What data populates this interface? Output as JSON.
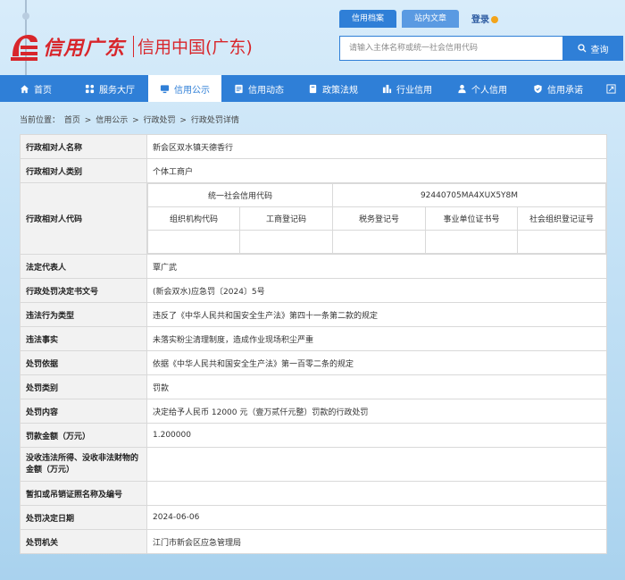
{
  "header": {
    "logo_script": "信用广东",
    "logo_name": "信用中国(广东)",
    "search_tabs": [
      "信用档案",
      "站内文章"
    ],
    "login_label": "登录",
    "search_placeholder": "请输入主体名称或统一社会信用代码",
    "search_button": "查询"
  },
  "nav": {
    "items": [
      {
        "label": "首页",
        "icon": "home-icon"
      },
      {
        "label": "服务大厅",
        "icon": "grid-icon"
      },
      {
        "label": "信用公示",
        "icon": "monitor-icon",
        "active": true
      },
      {
        "label": "信用动态",
        "icon": "news-icon"
      },
      {
        "label": "政策法规",
        "icon": "book-icon"
      },
      {
        "label": "行业信用",
        "icon": "building-icon"
      },
      {
        "label": "个人信用",
        "icon": "person-icon"
      },
      {
        "label": "信用承诺",
        "icon": "shield-icon"
      }
    ],
    "extra_icon": "expand-icon"
  },
  "breadcrumb": {
    "prefix": "当前位置：",
    "items": [
      "首页",
      "信用公示",
      "行政处罚",
      "行政处罚详情"
    ],
    "separator": ">"
  },
  "detail": {
    "name_label": "行政相对人名称",
    "name_value": "新会区双水镇天德香行",
    "type_label": "行政相对人类别",
    "type_value": "个体工商户",
    "code_label": "行政相对人代码",
    "usc_label": "统一社会信用代码",
    "usc_value": "92440705MA4XUX5Y8M",
    "sub_headers": [
      "组织机构代码",
      "工商登记码",
      "税务登记号",
      "事业单位证书号",
      "社会组织登记证号"
    ],
    "rep_label": "法定代表人",
    "rep_value": "覃广武",
    "doc_label": "行政处罚决定书文号",
    "doc_value": "(新会双水)应急罚〔2024〕5号",
    "violation_type_label": "违法行为类型",
    "violation_type_value": "违反了《中华人民共和国安全生产法》第四十一条第二款的规定",
    "facts_label": "违法事实",
    "facts_value": "未落实粉尘清理制度，造成作业现场积尘严重",
    "basis_label": "处罚依据",
    "basis_value": "依据《中华人民共和国安全生产法》第一百零二条的规定",
    "category_label": "处罚类别",
    "category_value": "罚款",
    "content_label": "处罚内容",
    "content_value": "决定给予人民币 12000 元（壹万贰仟元整）罚款的行政处罚",
    "amount_label": "罚款金额（万元）",
    "amount_value": "1.200000",
    "confiscate_label": "没收违法所得、没收非法财物的金额（万元）",
    "confiscate_value": "",
    "suspend_label": "暂扣或吊销证照名称及编号",
    "suspend_value": "",
    "date_label": "处罚决定日期",
    "date_value": "2024-06-06",
    "authority_label": "处罚机关",
    "authority_value": "江门市新会区应急管理局"
  },
  "colors": {
    "primary": "#2f7fd7",
    "brand_red": "#d8262b",
    "label_bg": "#f2f2f2"
  }
}
